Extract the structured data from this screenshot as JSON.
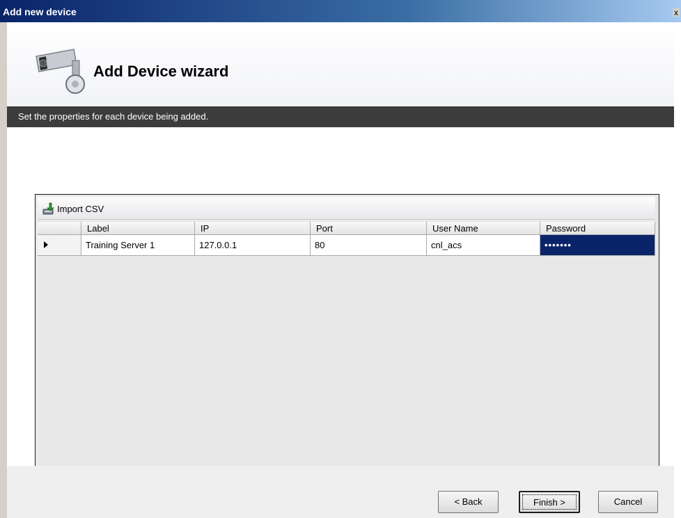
{
  "window": {
    "title": "Add new device",
    "close_glyph": "x"
  },
  "header": {
    "heading": "Add Device wizard",
    "icon": "security-camera-icon"
  },
  "subbar": {
    "text": "Set the properties for each device being added."
  },
  "toolbar": {
    "import_label": "Import CSV",
    "import_icon": "import-csv-icon"
  },
  "table": {
    "columns": [
      "Label",
      "IP",
      "Port",
      "User Name",
      "Password"
    ],
    "rows": [
      {
        "label": "Training Server 1",
        "ip": "127.0.0.1",
        "port": "80",
        "user": "cnl_acs",
        "password": "•••••••"
      }
    ]
  },
  "footer": {
    "back_label": "< Back",
    "finish_label": "Finish >",
    "cancel_label": "Cancel"
  },
  "colors": {
    "selection": "#0a246a",
    "subbar": "#3c3c3c"
  }
}
